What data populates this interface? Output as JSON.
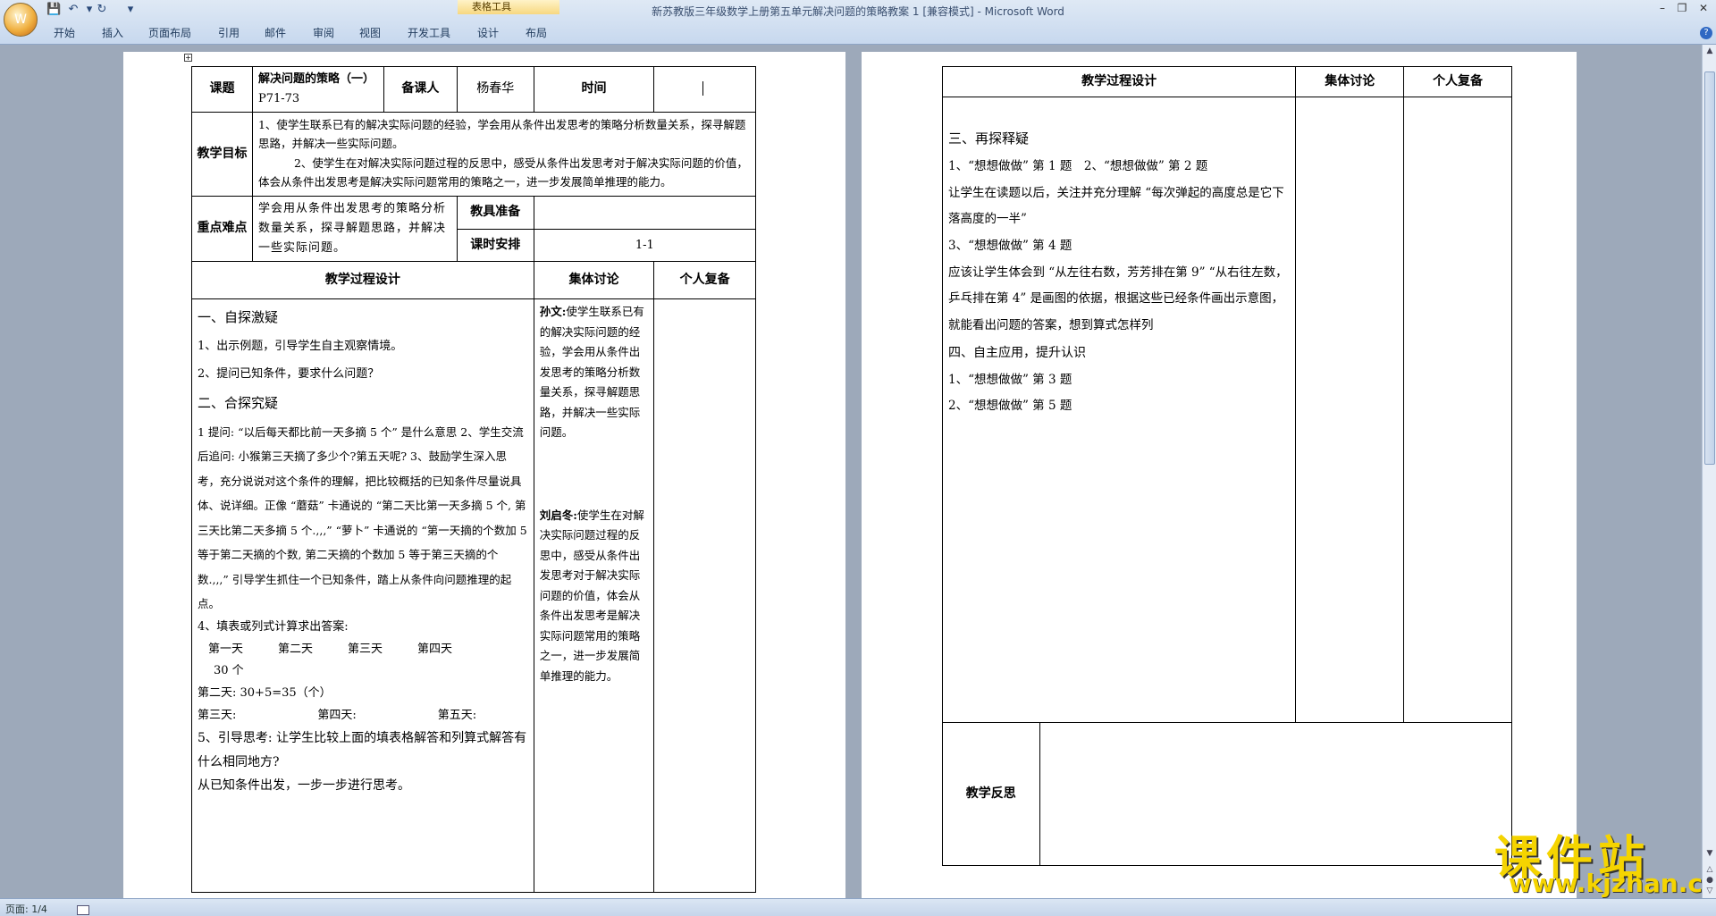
{
  "window": {
    "title": "新苏教版三年级数学上册第五单元解决问题的策略教案 1 [兼容模式] - Microsoft Word",
    "context_tab": "表格工具"
  },
  "ribbon": {
    "tabs": [
      "开始",
      "插入",
      "页面布局",
      "引用",
      "邮件",
      "审阅",
      "视图",
      "开发工具",
      "设计",
      "布局"
    ]
  },
  "status": {
    "page": "页面: 1/4"
  },
  "watermark": {
    "logo": "课件站",
    "url": "www.kjzhan.com"
  },
  "page1": {
    "lbl_topic": "课题",
    "topic": "解决问题的策略（一）",
    "pages": "P71-73",
    "lbl_preparer": "备课人",
    "preparer": "杨春华",
    "lbl_time": "时间",
    "lbl_goal": "教学目标",
    "goal_1": "1、使学生联系已有的解决实际问题的经验，学会用从条件出发思考的策略分析数量关系，探寻解题思路，并解决一些实际问题。",
    "goal_2": "2、使学生在对解决实际问题过程的反思中，感受从条件出发思考对于解决实际问题的价值，体会从条件出发思考是解决实际问题常用的策略之一，进一步发展简单推理的能力。",
    "lbl_key": "重点难点",
    "key": "学会用从条件出发思考的策略分析数量关系，探寻解题思路，并解决一些实际问题。",
    "lbl_tools": "教具准备",
    "tools": "",
    "lbl_hours": "课时安排",
    "hours": "1-1",
    "h_process": "教学过程设计",
    "h_group": "集体讨论",
    "h_personal": "个人复备",
    "process": [
      "一、自探激疑",
      "1、出示例题，引导学生自主观察情境。",
      "2、提问已知条件，要求什么问题？",
      "二、合探究疑",
      "1 提问: “以后每天都比前一天多摘 5 个” 是什么意思   2、学生交流后追问: 小猴第三天摘了多少个?第五天呢?   3、鼓励学生深入思考，充分说说对这个条件的理解，把比较概括的已知条件尽量说具体、说详细。正像 “蘑菇” 卡通说的 “第二天比第一天多摘 5 个, 第三天比第二天多摘 5 个.,,,” “萝卜” 卡通说的 “第一天摘的个数加 5 等于第二天摘的个数, 第二天摘的个数加 5 等于第三天摘的个数.,,,” 引导学生抓住一个已知条件，踏上从条件向问题推理的起点。",
      "4、填表或列式计算求出答案:",
      "第一天　　　第二天　　　第三天　　　第四天",
      "30 个",
      "第二天: 30+5=35（个）",
      "第三天:　　　　　　　第四天:　　　　　　　第五天:",
      "5、引导思考: 让学生比较上面的填表格解答和列算式解答有什么相同地方?",
      "从已知条件出发，一步一步进行思考。"
    ],
    "group_1_name": "孙文:",
    "group_1": "使学生联系已有的解决实际问题的经验，学会用从条件出发思考的策略分析数量关系，探寻解题思路，并解决一些实际问题。",
    "group_2_name": "刘启冬:",
    "group_2": "使学生在对解决实际问题过程的反思中，感受从条件出发思考对于解决实际问题的价值，体会从条件出发思考是解决实际问题常用的策略之一，进一步发展简单推理的能力。"
  },
  "page2": {
    "h_process": "教学过程设计",
    "h_group": "集体讨论",
    "h_personal": "个人复备",
    "process": [
      "三、再探释疑",
      "1、“想想做做” 第 1 题　2、“想想做做” 第 2 题",
      "让学生在读题以后，关注并充分理解 “每次弹起的高度总是它下落高度的一半”",
      "3、“想想做做” 第 4 题",
      "应该让学生体会到 “从左往右数，芳芳排在第 9” “从右往左数，乒乓排在第 4” 是画图的依据，根据这些已经条件画出示意图，就能看出问题的答案，想到算式怎样列",
      "四、自主应用，提升认识",
      "1、“想想做做” 第 3 题",
      "2、“想想做做” 第 5 题"
    ],
    "lbl_reflect": "教学反思"
  }
}
